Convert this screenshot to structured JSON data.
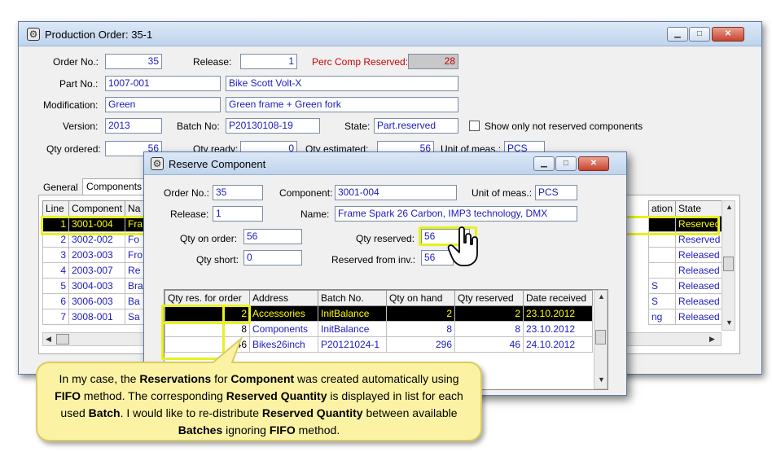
{
  "main_window": {
    "title": "Production Order: 35-1",
    "order_no_label": "Order No.:",
    "order_no": "35",
    "release_label": "Release:",
    "release": "1",
    "perc_comp_label": "Perc Comp Reserved:",
    "perc_comp": "28",
    "part_no_label": "Part No.:",
    "part_no": "1007-001",
    "part_name": "Bike Scott Volt-X",
    "modification_label": "Modification:",
    "modification": "Green",
    "modification_desc": "Green frame + Green fork",
    "version_label": "Version:",
    "version": "2013",
    "batch_no_label": "Batch No:",
    "batch_no": "P20130108-19",
    "state_label": "State:",
    "state": "Part.reserved",
    "show_only_label": "Show only not reserved components",
    "qty_ordered_label": "Qty ordered:",
    "qty_ordered": "56",
    "qty_ready_label": "Qty ready:",
    "qty_ready": "0",
    "qty_estimated_label": "Qty estimated:",
    "qty_estimated": "56",
    "unit_label": "Unit of meas.:",
    "unit": "PCS",
    "tabs": [
      "General",
      "Components"
    ],
    "grid_headers": [
      "Line",
      "Component",
      "Na",
      "ation",
      "State"
    ],
    "grid_rows": [
      {
        "line": "1",
        "component": "3001-004",
        "name": "Fra",
        "location": "",
        "state": "Reserved"
      },
      {
        "line": "2",
        "component": "3002-002",
        "name": "Fo",
        "location": "",
        "state": "Reserved"
      },
      {
        "line": "3",
        "component": "2003-003",
        "name": "Fro",
        "location": "",
        "state": "Released"
      },
      {
        "line": "4",
        "component": "2003-007",
        "name": "Re",
        "location": "",
        "state": "Released"
      },
      {
        "line": "5",
        "component": "3004-003",
        "name": "Bra",
        "location": "S",
        "state": "Released"
      },
      {
        "line": "6",
        "component": "3006-003",
        "name": "Ba",
        "location": "S",
        "state": "Released"
      },
      {
        "line": "7",
        "component": "3008-001",
        "name": "Sa",
        "location": "ng",
        "state": "Released"
      }
    ]
  },
  "dialog": {
    "title": "Reserve Component",
    "order_no_label": "Order No.:",
    "order_no": "35",
    "component_label": "Component:",
    "component": "3001-004",
    "unit_label": "Unit of meas.:",
    "unit": "PCS",
    "release_label": "Release:",
    "release": "1",
    "name_label": "Name:",
    "name": "Frame Spark 26 Carbon, IMP3 technology, DMX",
    "qty_on_order_label": "Qty on order:",
    "qty_on_order": "56",
    "qty_reserved_label": "Qty reserved:",
    "qty_reserved": "56",
    "qty_short_label": "Qty short:",
    "qty_short": "0",
    "reserved_from_inv_label": "Reserved from inv.:",
    "reserved_from_inv": "56",
    "grid_headers": [
      "Qty res. for order",
      "Address",
      "Batch No.",
      "Qty on hand",
      "Qty reserved",
      "Date received"
    ],
    "grid_rows": [
      {
        "qty_res": "2",
        "address": "Accessories",
        "batch": "InitBalance",
        "on_hand": "2",
        "reserved": "2",
        "date": "23.10.2012"
      },
      {
        "qty_res": "8",
        "address": "Components",
        "batch": "InitBalance",
        "on_hand": "8",
        "reserved": "8",
        "date": "23.10.2012"
      },
      {
        "qty_res": "46",
        "address": "Bikes26inch",
        "batch": "P20121024-1",
        "on_hand": "296",
        "reserved": "46",
        "date": "24.10.2012"
      }
    ]
  },
  "callout": {
    "t1": "In my case, the ",
    "b1": "Reservations",
    "t2": " for ",
    "b2": "Component",
    "t3": "  was created automatically using ",
    "b3": "FIFO",
    "t4": " method. The corresponding ",
    "b4": "Reserved Quantity",
    "t5": " is displayed in list for each used ",
    "b5": "Batch",
    "t6": ". I would like to re-distribute ",
    "b6": "Reserved Quantity",
    "t7": " between available ",
    "b7": "Batches",
    "t8": " ignoring ",
    "b8": "FIFO",
    "t9": " method."
  },
  "colors": {
    "highlight": "#e8f020",
    "selected_text": "#ffff00",
    "value_text": "#1b1bbf",
    "label_red": "#cc0000"
  }
}
